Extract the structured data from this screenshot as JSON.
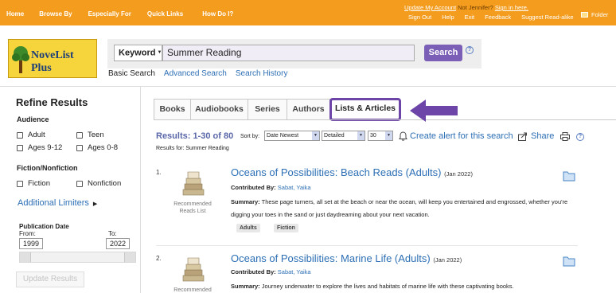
{
  "topnav": {
    "items": [
      "Home",
      "Browse By",
      "Especially For",
      "Quick Links",
      "How Do I?"
    ]
  },
  "account": {
    "update": "Update My Account",
    "not_user": "Not Jennifer?",
    "sign_in": "Sign in here.",
    "links": [
      "Sign Out",
      "Help",
      "Exit",
      "Feedback",
      "Suggest Read-alike"
    ],
    "folder": "Folder"
  },
  "logo": {
    "text": "NoveList Plus"
  },
  "search": {
    "field_type": "Keyword",
    "query": "Summer Reading",
    "button": "Search",
    "help": "?",
    "links": [
      "Basic Search",
      "Advanced Search",
      "Search History"
    ]
  },
  "sidebar": {
    "title": "Refine Results",
    "audience": {
      "label": "Audience",
      "options": [
        "Adult",
        "Teen",
        "Ages 9-12",
        "Ages 0-8"
      ]
    },
    "fiction": {
      "label": "Fiction/Nonfiction",
      "options": [
        "Fiction",
        "Nonfiction"
      ]
    },
    "additional": "Additional Limiters",
    "pubdate": {
      "label": "Publication Date",
      "from_label": "From:",
      "to_label": "To:",
      "from": "1999",
      "to": "2022"
    },
    "update_button": "Update Results"
  },
  "tabs": [
    "Books",
    "Audiobooks",
    "Series",
    "Authors",
    "Lists & Articles"
  ],
  "active_tab": "Lists & Articles",
  "results_bar": {
    "count": "Results: 1-30 of 80",
    "sort_label": "Sort by:",
    "sort": "Date Newest",
    "view": "Detailed",
    "per_page": "30",
    "alert": "Create alert for this search",
    "share": "Share",
    "results_for": "Results for: Summer Reading"
  },
  "results": [
    {
      "num": "1.",
      "type_label": "Recommended Reads List",
      "title": "Oceans of Possibilities: Beach Reads (Adults)",
      "date": "(Jan 2022)",
      "contributed_label": "Contributed By:",
      "author": "Sabat, Yaika",
      "summary_label": "Summary:",
      "summary": "These page turners, all set at the beach or near the ocean, will keep you entertained and engrossed, whether you're digging your toes in the sand or just daydreaming about your next vacation.",
      "tags": [
        "Adults",
        "Fiction"
      ]
    },
    {
      "num": "2.",
      "type_label": "Recommended",
      "title": "Oceans of Possibilities: Marine Life (Adults)",
      "date": "(Jan 2022)",
      "contributed_label": "Contributed By:",
      "author": "Sabat, Yaika",
      "summary_label": "Summary:",
      "summary": "Journey underwater to explore the lives and habitats of marine life with these captivating books."
    }
  ],
  "colors": {
    "header": "#f39c1e",
    "accent": "#6d45a8",
    "link": "#2d6fb5"
  }
}
